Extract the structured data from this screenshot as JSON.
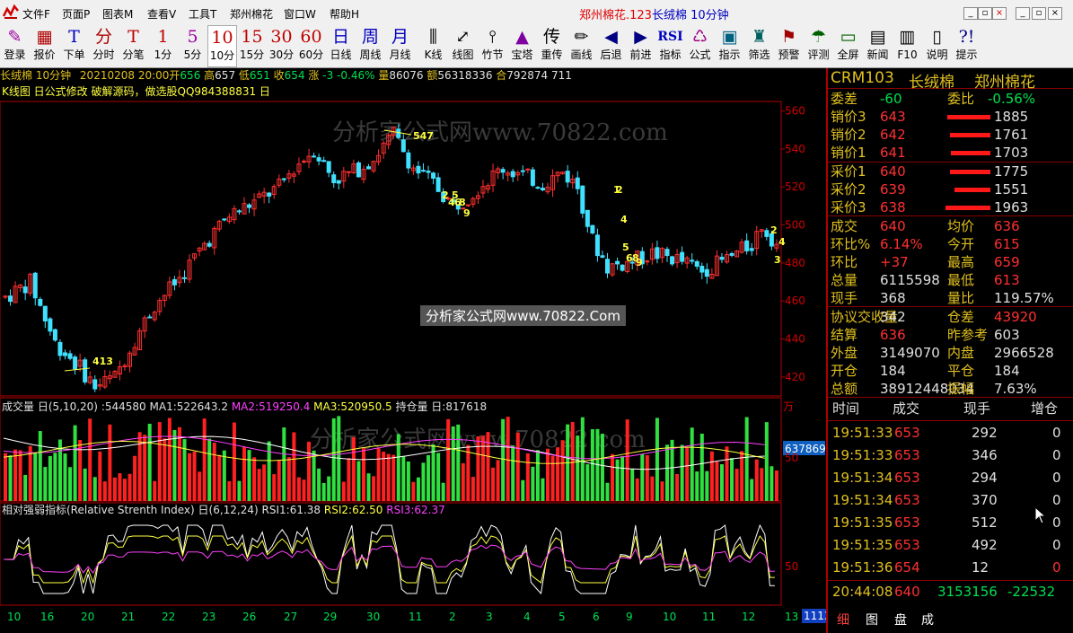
{
  "app": {
    "menus": [
      "文件F",
      "页面P",
      "图表M",
      "查看V",
      "工具T",
      "郑州棉花",
      "窗口W",
      "帮助H"
    ],
    "title_red": "郑州棉花.123",
    "title_blue": "长绒棉 10分钟"
  },
  "toolbar": [
    {
      "icon": "✎",
      "label": "登录"
    },
    {
      "icon": "▦",
      "label": "报价"
    },
    {
      "icon": "T",
      "label": "下单"
    },
    {
      "icon": "分",
      "label": "分时"
    },
    {
      "icon": "T",
      "label": "分笔"
    },
    {
      "icon": "1",
      "label": "1分"
    },
    {
      "icon": "5",
      "label": "5分"
    },
    {
      "icon": "10",
      "label": "10分"
    },
    {
      "icon": "15",
      "label": "15分"
    },
    {
      "icon": "30",
      "label": "30分"
    },
    {
      "icon": "60",
      "label": "60分"
    },
    {
      "icon": "日",
      "label": "日线"
    },
    {
      "icon": "周",
      "label": "周线"
    },
    {
      "icon": "月",
      "label": "月线"
    },
    {
      "icon": "⫼",
      "label": "K线"
    },
    {
      "icon": "⤢",
      "label": "线图"
    },
    {
      "icon": "⫯",
      "label": "竹节"
    },
    {
      "icon": "▲",
      "label": "宝塔"
    },
    {
      "icon": "传",
      "label": "重传"
    },
    {
      "icon": "✏",
      "label": "画线"
    },
    {
      "icon": "◀",
      "label": "后退"
    },
    {
      "icon": "▶",
      "label": "前进"
    },
    {
      "icon": "RSI",
      "label": "指标"
    },
    {
      "icon": "♺",
      "label": "公式"
    },
    {
      "icon": "▣",
      "label": "指示"
    },
    {
      "icon": "♜",
      "label": "筛选"
    },
    {
      "icon": "⚑",
      "label": "预警"
    },
    {
      "icon": "☂",
      "label": "评测"
    },
    {
      "icon": "▭",
      "label": "全屏"
    },
    {
      "icon": "▤",
      "label": "新闻"
    },
    {
      "icon": "▥",
      "label": "F10"
    },
    {
      "icon": "▯",
      "label": "说明"
    },
    {
      "icon": "?!",
      "label": "提示"
    }
  ],
  "info_line": {
    "name": "长绒棉 10分钟",
    "date": "20210208 20:00",
    "open_label": "开",
    "open": "656",
    "high_label": "高",
    "high": "657",
    "low_label": "低",
    "low": "651",
    "close_label": "收",
    "close": "654",
    "chg_label": "涨",
    "chg": "-3",
    "pct": "-0.46%",
    "vol_label": "量",
    "vol": "86076",
    "amt_label": "额",
    "amt": "56318336",
    "oi_label": "合",
    "oi": "792874",
    "last": "711"
  },
  "kline_label": "K线图 日公式修改 破解源码，做选股QQ984388831 日",
  "watermark": "分析家公式网www.70822.com",
  "watermark_box": "分析家公式网www.70822.Com",
  "price_axis": [
    "560",
    "540",
    "520",
    "500",
    "480",
    "460",
    "440",
    "420"
  ],
  "volume_header": {
    "name": "成交量 日(5,10,20)",
    "v": ":544580",
    "ma1": "MA1:522643.2",
    "ma2": "MA2:519250.4",
    "ma3": "MA3:520950.5",
    "oi": "持仓量 日:817618"
  },
  "volume_axis": {
    "unit": "万",
    "mid": "637869",
    "ref": "50"
  },
  "rsi_header": {
    "name": "相对强弱指标(Relative Strenth Index) 日(6,12,24)",
    "r1": "RSI1:61.38",
    "r2": "RSI2:62.50",
    "r3": "RSI3:62.37"
  },
  "rsi_axis": "50",
  "date_axis": [
    "10",
    "16",
    "20",
    "21",
    "22",
    "23",
    "26",
    "27",
    "29",
    "30",
    "11",
    "2",
    "3",
    "4",
    "5",
    "6",
    "9",
    "10",
    "11",
    "12",
    "13"
  ],
  "date_axis_end": "1113",
  "annotations": [
    "547",
    "413",
    "2",
    "5",
    "4",
    "6",
    "8",
    "9",
    "1",
    "2",
    "4",
    "5",
    "6",
    "8",
    "9",
    "2",
    "4",
    "3"
  ],
  "quote": {
    "code": "CRM103",
    "name": "长绒棉",
    "exchange": "郑州棉花",
    "wei_cha_label": "委差",
    "wei_cha": "-60",
    "wei_bi_label": "委比",
    "wei_bi": "-0.56%",
    "asks": [
      {
        "label": "销价3",
        "price": "643",
        "vol": "1885",
        "bar": 0.96
      },
      {
        "label": "销价2",
        "price": "642",
        "vol": "1761",
        "bar": 0.9
      },
      {
        "label": "销价1",
        "price": "641",
        "vol": "1703",
        "bar": 0.87
      }
    ],
    "bids": [
      {
        "label": "采价1",
        "price": "640",
        "vol": "1775",
        "bar": 0.9
      },
      {
        "label": "采价2",
        "price": "639",
        "vol": "1551",
        "bar": 0.79
      },
      {
        "label": "采价3",
        "price": "638",
        "vol": "1963",
        "bar": 1.0
      }
    ],
    "stats": [
      {
        "l1": "成交",
        "v1": "640",
        "c1": "red",
        "l2": "均价",
        "v2": "636",
        "c2": "red"
      },
      {
        "l1": "环比%",
        "v1": "6.14%",
        "c1": "red",
        "l2": "今开",
        "v2": "615",
        "c2": "red"
      },
      {
        "l1": "环比",
        "v1": "+37",
        "c1": "red",
        "l2": "最高",
        "v2": "659",
        "c2": "red"
      },
      {
        "l1": "总量",
        "v1": "6115598",
        "c1": "white",
        "l2": "最低",
        "v2": "613",
        "c2": "red"
      },
      {
        "l1": "现手",
        "v1": "368",
        "c1": "white",
        "l2": "量比",
        "v2": "119.57%",
        "c2": "white"
      },
      {
        "l1": "协议交收量",
        "v1": "342",
        "c1": "white",
        "l2": "仓差",
        "v2": "43920",
        "c2": "red"
      },
      {
        "l1": "结算",
        "v1": "636",
        "c1": "red",
        "l2": "昨参考",
        "v2": "603",
        "c2": "white"
      },
      {
        "l1": "外盘",
        "v1": "3149070",
        "c1": "white",
        "l2": "内盘",
        "v2": "2966528",
        "c2": "white"
      },
      {
        "l1": "开仓",
        "v1": "184",
        "c1": "white",
        "l2": "平仓",
        "v2": "184",
        "c2": "white"
      },
      {
        "l1": "总额",
        "v1": "38912448034",
        "c1": "white",
        "l2": "振幅",
        "v2": "7.63%",
        "c2": "white"
      }
    ]
  },
  "trades": {
    "headers": [
      "时间",
      "成交",
      "现手",
      "增仓"
    ],
    "rows": [
      [
        "19:51:33",
        "653",
        "292",
        "0"
      ],
      [
        "19:51:33",
        "653",
        "346",
        "0"
      ],
      [
        "19:51:34",
        "653",
        "294",
        "0"
      ],
      [
        "19:51:34",
        "653",
        "370",
        "0"
      ],
      [
        "19:51:35",
        "653",
        "512",
        "0"
      ],
      [
        "19:51:35",
        "653",
        "492",
        "0"
      ],
      [
        "19:51:36",
        "654",
        "12",
        "0"
      ]
    ],
    "last": [
      "20:44:08",
      "640",
      "3153156",
      "-22532"
    ]
  },
  "tabs": [
    "细",
    "图",
    "盘",
    "成"
  ],
  "colors": {
    "up": "#ff3030",
    "down": "#40e0ff",
    "bg": "#000000",
    "axis": "#c00000",
    "ma1": "#ffffff",
    "ma2": "#ff40ff",
    "ma3": "#ffff40"
  },
  "chart_data": {
    "type": "candlestick",
    "title": "长绒棉 10分钟",
    "y_axis_range": [
      410,
      565
    ],
    "ticks": [
      420,
      440,
      460,
      480,
      500,
      520,
      540,
      560
    ],
    "key_points": [
      {
        "label": "low",
        "value": 413
      },
      {
        "label": "high",
        "value": 547
      },
      {
        "label": "last_open",
        "value": 656
      },
      {
        "label": "last_close",
        "value": 654
      }
    ],
    "profile": [
      [
        0,
        462
      ],
      [
        5,
        470
      ],
      [
        10,
        438
      ],
      [
        15,
        425
      ],
      [
        18,
        415
      ],
      [
        22,
        420
      ],
      [
        26,
        440
      ],
      [
        30,
        458
      ],
      [
        35,
        472
      ],
      [
        40,
        490
      ],
      [
        45,
        505
      ],
      [
        50,
        512
      ],
      [
        55,
        520
      ],
      [
        58,
        530
      ],
      [
        62,
        540
      ],
      [
        66,
        524
      ],
      [
        70,
        528
      ],
      [
        74,
        535
      ],
      [
        78,
        548
      ],
      [
        82,
        530
      ],
      [
        86,
        522
      ],
      [
        90,
        510
      ],
      [
        93,
        515
      ],
      [
        96,
        522
      ],
      [
        100,
        530
      ],
      [
        104,
        526
      ],
      [
        108,
        522
      ],
      [
        112,
        528
      ],
      [
        115,
        520
      ],
      [
        118,
        492
      ],
      [
        121,
        478
      ],
      [
        125,
        480
      ],
      [
        130,
        485
      ],
      [
        135,
        482
      ],
      [
        140,
        476
      ],
      [
        145,
        482
      ],
      [
        150,
        490
      ],
      [
        152,
        500
      ],
      [
        155,
        490
      ]
    ]
  }
}
